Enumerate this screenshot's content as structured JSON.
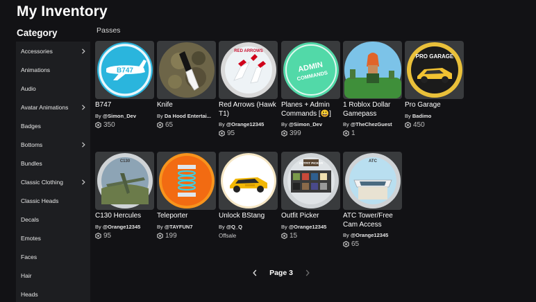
{
  "page": {
    "title": "My Inventory"
  },
  "sidebar": {
    "title": "Category",
    "items": [
      {
        "label": "Accessories",
        "has_submenu": true
      },
      {
        "label": "Animations",
        "has_submenu": false
      },
      {
        "label": "Audio",
        "has_submenu": false
      },
      {
        "label": "Avatar Animations",
        "has_submenu": true
      },
      {
        "label": "Badges",
        "has_submenu": false
      },
      {
        "label": "Bottoms",
        "has_submenu": true
      },
      {
        "label": "Bundles",
        "has_submenu": false
      },
      {
        "label": "Classic Clothing",
        "has_submenu": true
      },
      {
        "label": "Classic Heads",
        "has_submenu": false
      },
      {
        "label": "Decals",
        "has_submenu": false
      },
      {
        "label": "Emotes",
        "has_submenu": false
      },
      {
        "label": "Faces",
        "has_submenu": false
      },
      {
        "label": "Hair",
        "has_submenu": false
      },
      {
        "label": "Heads",
        "has_submenu": false
      }
    ]
  },
  "section": {
    "label": "Passes"
  },
  "items": [
    {
      "name": "B747",
      "by": "By",
      "creator": "@Simon_Dev",
      "price": "350",
      "thumb_text": "B747"
    },
    {
      "name": "Knife",
      "by": "By",
      "creator": "Da Hood Entertai...",
      "price": "65"
    },
    {
      "name": "Red Arrows (Hawk T1)",
      "by": "By",
      "creator": "@Orange12345",
      "price": "95",
      "thumb_text": "RED ARROWS"
    },
    {
      "name": "Planes + Admin Commands [😃]",
      "by": "By",
      "creator": "@Simon_Dev",
      "price": "399",
      "thumb_text": "ADMIN COMMANDS"
    },
    {
      "name": "1 Roblox Dollar Gamepass",
      "by": "By",
      "creator": "@TheChezGuest",
      "price": "1"
    },
    {
      "name": "Pro Garage",
      "by": "By",
      "creator": "Badimo",
      "price": "450",
      "thumb_text": "PRO GARAGE"
    },
    {
      "name": "C130 Hercules",
      "by": "By",
      "creator": "@Orange12345",
      "price": "95",
      "thumb_text": "C130"
    },
    {
      "name": "Teleporter",
      "by": "By",
      "creator": "@TAYFUN7",
      "price": "199"
    },
    {
      "name": "Unlock BStang",
      "by": "By",
      "creator": "@Q_Q",
      "price": "",
      "status": "Offsale"
    },
    {
      "name": "Outfit Picker",
      "by": "By",
      "creator": "@Orange12345",
      "price": "15",
      "thumb_text": "OUTFIT PICKER"
    },
    {
      "name": "ATC Tower/Free Cam Access",
      "by": "By",
      "creator": "@Orange12345",
      "price": "65",
      "thumb_text": "ATC"
    }
  ],
  "pagination": {
    "label": "Page 3"
  },
  "colors": {
    "background": "#121215",
    "sidebar": "#1d1e21",
    "card": "#393b3d",
    "text": "#ffffff"
  }
}
